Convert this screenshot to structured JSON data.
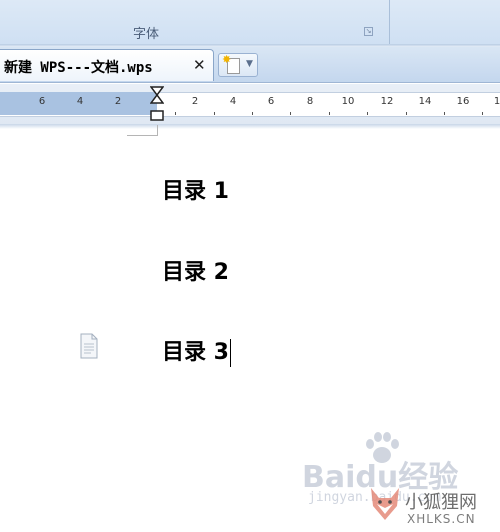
{
  "ribbon": {
    "group_label": "字体",
    "launcher_icon": "dialog-launcher-icon"
  },
  "tabbar": {
    "document_tab": {
      "title": "新建 WPS---文档.wps",
      "close_icon": "close-icon"
    },
    "new_tab_button": {
      "icon": "new-document-icon",
      "dropdown_icon": "chevron-down-icon"
    }
  },
  "ruler": {
    "labels": [
      "6",
      "4",
      "2",
      "2",
      "4",
      "6",
      "8",
      "10",
      "12",
      "14",
      "16",
      "1"
    ],
    "indent_marker_icon": "indent-marker-icon"
  },
  "document": {
    "lines": [
      "目录 1",
      "目录 2",
      "目录 3"
    ],
    "paragraph_icon": "paragraph-layout-icon"
  },
  "watermarks": {
    "baidu_logo": "Baidu经验",
    "baidu_url": "jingyan.baidu.com",
    "site_name": "小狐狸网",
    "site_domain": "XHLKS.CN"
  },
  "colors": {
    "ribbon_bg": "#cfe0f3",
    "ruler_margin": "#a9c2e1",
    "text": "#000000"
  }
}
